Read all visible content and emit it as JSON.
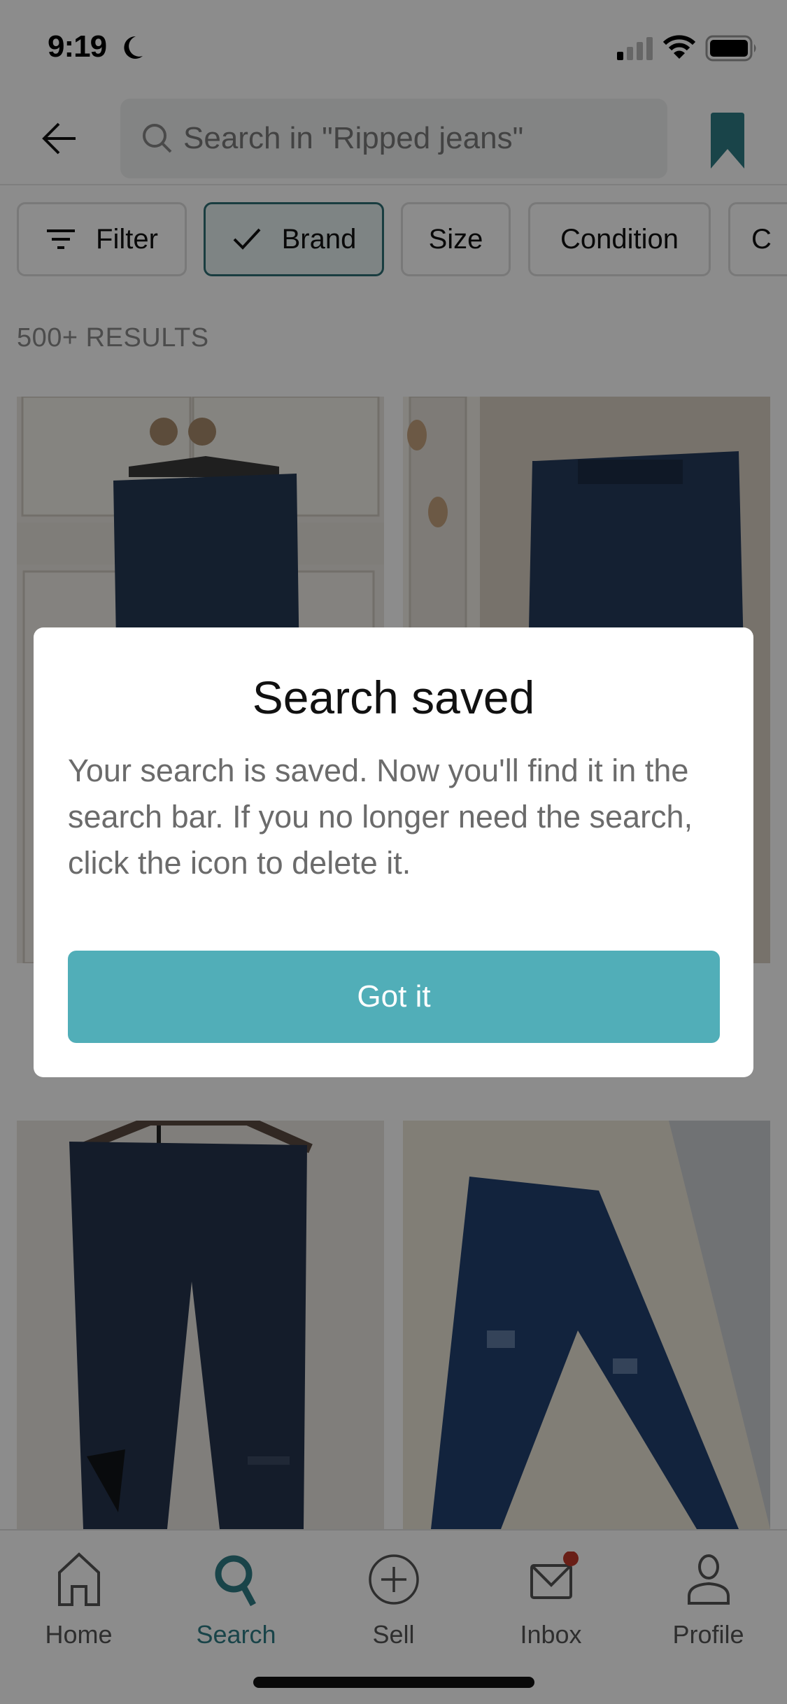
{
  "status_bar": {
    "time": "9:19",
    "focus_icon": "moon-icon",
    "signal_icon": "cellular-signal-icon",
    "wifi_icon": "wifi-icon",
    "battery_icon": "battery-icon"
  },
  "header": {
    "back_icon": "arrow-left-icon",
    "search_placeholder": "Search in \"Ripped jeans\"",
    "search_icon": "search-icon",
    "bookmark_icon": "bookmark-filled-icon"
  },
  "filters": {
    "chips": [
      {
        "label": "Filter",
        "icon": "filter-icon",
        "active": false
      },
      {
        "label": "Brand",
        "icon": "check-icon",
        "active": true
      },
      {
        "label": "Size",
        "active": false
      },
      {
        "label": "Condition",
        "active": false
      },
      {
        "label": "C",
        "active": false
      }
    ]
  },
  "results": {
    "count_label": "500+ RESULTS"
  },
  "products": [
    {
      "description": "Dark blue jeans on hanger against white cupboard"
    },
    {
      "description": "Dark blue jeans hanging on door against carpet"
    },
    {
      "description": "Dark jeans with ripped knee on wooden hanger"
    },
    {
      "description": "Blue ripped biker jeans laid on bed"
    }
  ],
  "modal": {
    "title": "Search saved",
    "body": "Your search is saved. Now you'll find it in the search bar. If you no longer need the search, click the icon to delete it.",
    "button_label": "Got it"
  },
  "tab_bar": {
    "tabs": [
      {
        "label": "Home",
        "icon": "home-icon",
        "active": false
      },
      {
        "label": "Search",
        "icon": "search-icon",
        "active": true
      },
      {
        "label": "Sell",
        "icon": "plus-circle-icon",
        "active": false
      },
      {
        "label": "Inbox",
        "icon": "mail-icon",
        "active": false,
        "badge": true
      },
      {
        "label": "Profile",
        "icon": "user-icon",
        "active": false
      }
    ]
  },
  "colors": {
    "brand_teal": "#2f7c85",
    "button_teal": "#51aeb8",
    "badge_red": "#c0392b"
  }
}
